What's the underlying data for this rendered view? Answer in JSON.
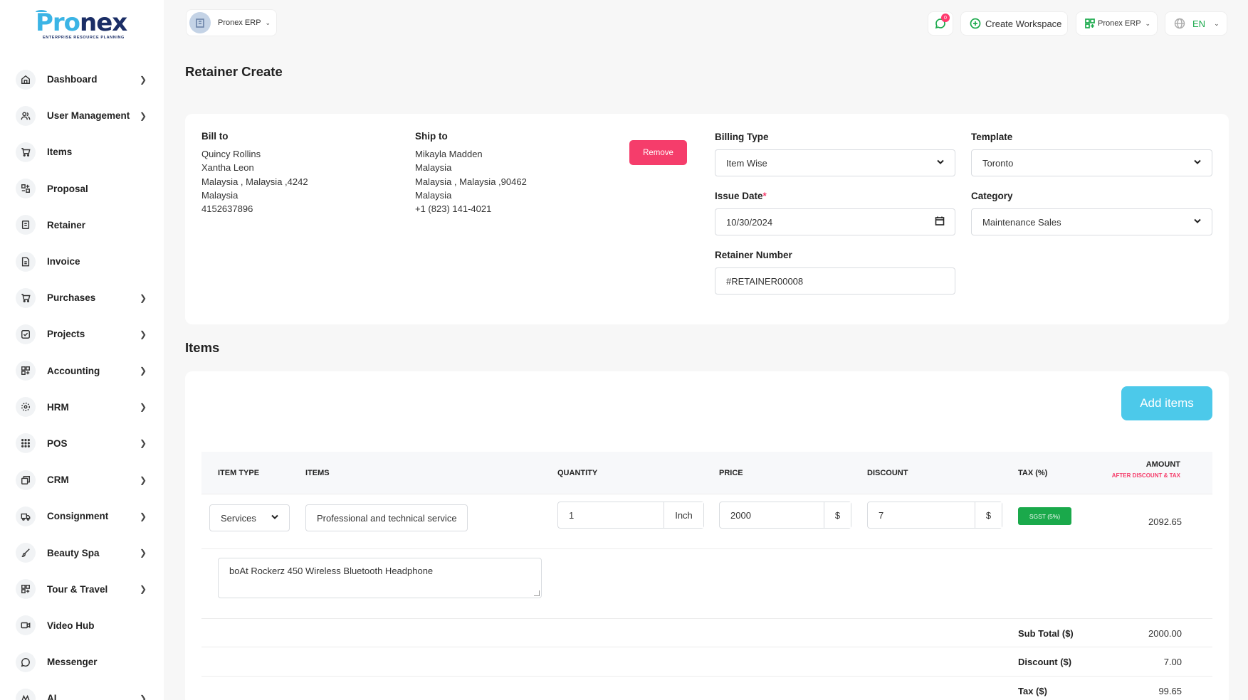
{
  "brand": {
    "logo_part1": "Pro",
    "logo_part2": "nex",
    "tagline": "ENTERPRISE RESOURCE PLANNING"
  },
  "sidebar": {
    "items": [
      {
        "label": "Dashboard",
        "icon": "home-icon",
        "has_chevron": true
      },
      {
        "label": "User Management",
        "icon": "users-icon",
        "has_chevron": true
      },
      {
        "label": "Items",
        "icon": "cart-icon",
        "has_chevron": false
      },
      {
        "label": "Proposal",
        "icon": "proposal-icon",
        "has_chevron": false
      },
      {
        "label": "Retainer",
        "icon": "retainer-icon",
        "has_chevron": false
      },
      {
        "label": "Invoice",
        "icon": "invoice-icon",
        "has_chevron": false
      },
      {
        "label": "Purchases",
        "icon": "cart-icon",
        "has_chevron": true
      },
      {
        "label": "Projects",
        "icon": "checkbox-icon",
        "has_chevron": true
      },
      {
        "label": "Accounting",
        "icon": "grid-plus-icon",
        "has_chevron": true
      },
      {
        "label": "HRM",
        "icon": "hrm-icon",
        "has_chevron": true
      },
      {
        "label": "POS",
        "icon": "dots-grid-icon",
        "has_chevron": true
      },
      {
        "label": "CRM",
        "icon": "crm-icon",
        "has_chevron": true
      },
      {
        "label": "Consignment",
        "icon": "truck-icon",
        "has_chevron": true
      },
      {
        "label": "Beauty Spa",
        "icon": "brush-icon",
        "has_chevron": true
      },
      {
        "label": "Tour & Travel",
        "icon": "grid-plus-icon",
        "has_chevron": true
      },
      {
        "label": "Video Hub",
        "icon": "video-icon",
        "has_chevron": false
      },
      {
        "label": "Messenger",
        "icon": "chat-icon",
        "has_chevron": false
      },
      {
        "label": "AI",
        "icon": "ai-icon",
        "has_chevron": true
      }
    ]
  },
  "topbar": {
    "workspace_name": "Pronex ERP",
    "messages_badge": "0",
    "create_workspace": "Create Workspace",
    "erp_switch": "Pronex ERP",
    "language": "EN"
  },
  "page": {
    "title": "Retainer Create"
  },
  "bill_to": {
    "title": "Bill to",
    "lines": [
      "Quincy Rollins",
      "Xantha Leon",
      "Malaysia , Malaysia ,4242",
      "Malaysia",
      "4152637896"
    ]
  },
  "ship_to": {
    "title": "Ship to",
    "lines": [
      "Mikayla Madden",
      "Malaysia",
      "Malaysia , Malaysia ,90462",
      "Malaysia",
      "+1 (823) 141-4021"
    ]
  },
  "form": {
    "remove_label": "Remove",
    "billing_type_label": "Billing Type",
    "billing_type_value": "Item Wise",
    "template_label": "Template",
    "template_value": "Toronto",
    "issue_date_label": "Issue Date",
    "issue_date_required": "*",
    "issue_date_value": "10/30/2024",
    "category_label": "Category",
    "category_value": "Maintenance Sales",
    "retainer_number_label": "Retainer Number",
    "retainer_number_value": "#RETAINER00008"
  },
  "items_section": {
    "title": "Items",
    "add_button": "Add items",
    "headers": {
      "item_type": "ITEM TYPE",
      "items": "ITEMS",
      "quantity": "QUANTITY",
      "price": "PRICE",
      "discount": "DISCOUNT",
      "tax": "TAX (%)",
      "amount": "AMOUNT",
      "amount_note": "AFTER DISCOUNT & TAX"
    },
    "row": {
      "item_type": "Services",
      "item_name": "Professional and technical service",
      "quantity": "1",
      "unit": "Inch",
      "price": "2000",
      "price_currency": "$",
      "discount": "7",
      "discount_currency": "$",
      "tax_badge": "SGST (5%)",
      "amount": "2092.65",
      "description": "boAt Rockerz 450 Wireless Bluetooth Headphone"
    },
    "summary": {
      "subtotal_label": "Sub Total ($)",
      "subtotal_value": "2000.00",
      "discount_label": "Discount ($)",
      "discount_value": "7.00",
      "tax_label": "Tax ($)",
      "tax_value": "99.65"
    }
  },
  "colors": {
    "accent_green": "#1aa94b",
    "remove_red": "#f53d6b",
    "add_blue": "#4cc9ea",
    "brand_navy": "#1b2e66",
    "brand_cyan": "#3bb4e5"
  }
}
